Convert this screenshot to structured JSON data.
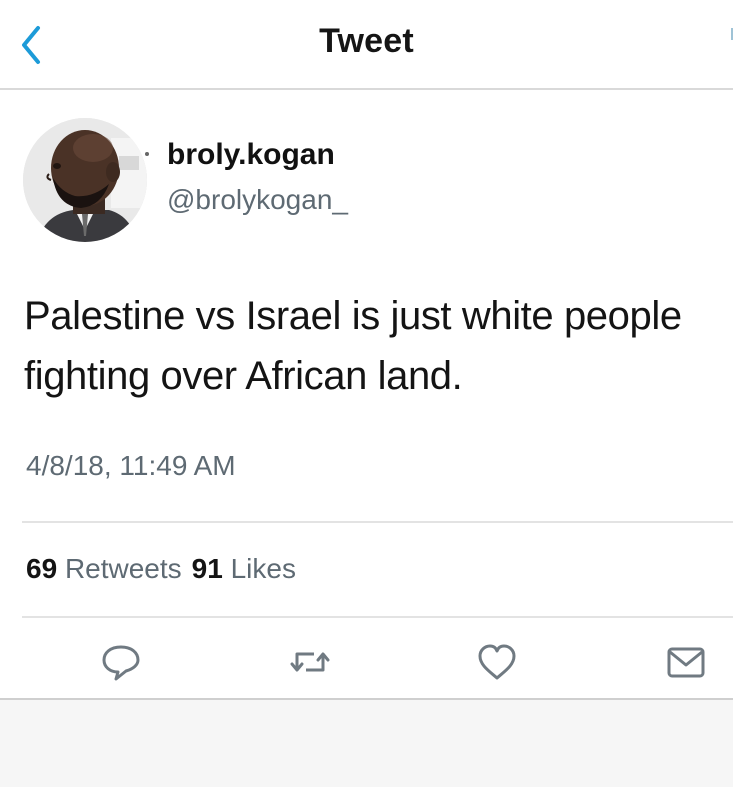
{
  "nav": {
    "title": "Tweet"
  },
  "author": {
    "name": "broly.kogan",
    "handle": "@brolykogan_"
  },
  "tweet": {
    "text": "Palestine vs Israel is just white people fighting over African land.",
    "timestamp": "4/8/18, 11:49 AM"
  },
  "stats": {
    "retweets_count": "69",
    "retweets_label": "Retweets",
    "likes_count": "91",
    "likes_label": "Likes"
  },
  "icons": {
    "back": "chevron-left-icon",
    "reply": "speech-bubble-icon",
    "retweet": "retweet-arrows-icon",
    "like": "heart-icon",
    "share": "envelope-icon"
  },
  "colors": {
    "accent": "#1d9bd8",
    "secondary_text": "#5e6a73",
    "primary_text": "#141414"
  }
}
